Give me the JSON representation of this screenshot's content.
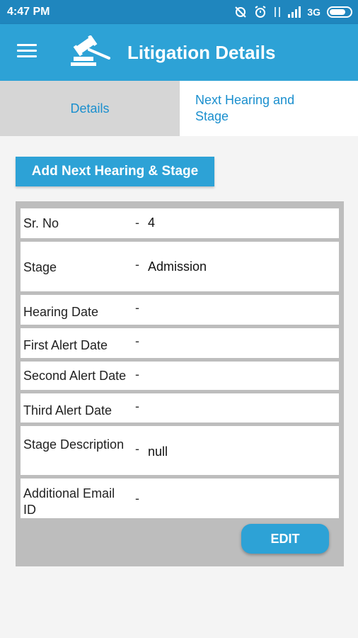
{
  "status_bar": {
    "time": "4:47 PM",
    "network": "3G"
  },
  "app_bar": {
    "title": "Litigation Details",
    "menu_icon": "hamburger-menu-icon",
    "logo_icon": "gavel-icon"
  },
  "tabs": [
    {
      "label": "Details",
      "active": false
    },
    {
      "label": "Next Hearing and Stage",
      "active": true
    }
  ],
  "add_button": {
    "label": "Add Next Hearing & Stage"
  },
  "fields": [
    {
      "label": "Sr. No",
      "separator": "-",
      "value": "4"
    },
    {
      "label": "Stage",
      "separator": "-",
      "value": "Admission"
    },
    {
      "label": "Hearing Date",
      "separator": "-",
      "value": ""
    },
    {
      "label": "First Alert Date",
      "separator": "-",
      "value": ""
    },
    {
      "label": "Second Alert Date",
      "separator": "-",
      "value": ""
    },
    {
      "label": "Third Alert Date",
      "separator": "-",
      "value": ""
    },
    {
      "label": "Stage Description",
      "separator": "-",
      "value": "null"
    },
    {
      "label": "Additional Email ID",
      "separator": "-",
      "value": ""
    }
  ],
  "edit_button": {
    "label": "EDIT"
  },
  "colors": {
    "status_bar": "#1f86be",
    "app_bar": "#2da2d6",
    "accent_text": "#1a8fce",
    "panel_bg": "#bdbdbd"
  }
}
